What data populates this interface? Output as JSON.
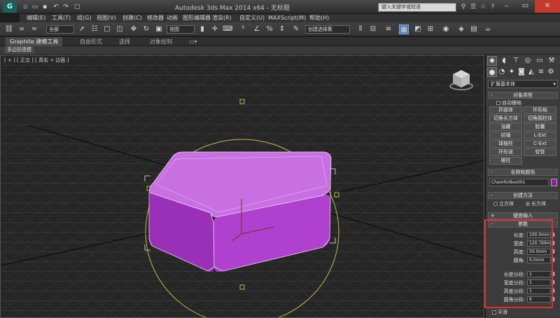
{
  "titlebar": {
    "app_logo": "G",
    "title": "Autodesk 3ds Max 2014 x64 - 无标题",
    "search_placeholder": "键入关键字或短语"
  },
  "menu": [
    "编辑(E)",
    "工具(T)",
    "组(G)",
    "视图(V)",
    "创建(C)",
    "修改器",
    "动画",
    "图形编辑器",
    "渲染(R)",
    "自定义(U)",
    "MAXScript(M)",
    "帮助(H)"
  ],
  "toolbar": {
    "selection_filter": "全部",
    "coord_system": "视图",
    "named_selection": "创建选择集"
  },
  "ribbon": {
    "tabs": [
      "Graphite 建模工具",
      "自由形式",
      "选择",
      "对象绘制"
    ],
    "subtab": "多边形建模"
  },
  "viewport": {
    "label": "[ + ] [ 正交 ] [ 真实 + 边面 ]"
  },
  "command_panel": {
    "category": "扩展基本体",
    "object_type": {
      "title": "对象类型",
      "autogrid": "自动栅格",
      "buttons": [
        "异面体",
        "环形结",
        "切角长方体",
        "切角圆柱体",
        "油罐",
        "胶囊",
        "纺锤",
        "L-Ext",
        "球棱柱",
        "C-Ext",
        "环形波",
        "软管",
        "棱柱"
      ]
    },
    "name_color": {
      "title": "名称和颜色",
      "name": "ChamferBox001",
      "color": "#8c1fa8"
    },
    "creation_method": {
      "title": "创建方法",
      "options": [
        "立方体",
        "长方体"
      ],
      "selected": "长方体"
    },
    "keyboard_entry": {
      "title": "键盘输入"
    },
    "parameters": {
      "title": "参数",
      "fields": [
        {
          "label": "长度:",
          "value": "100.0mm"
        },
        {
          "label": "宽度:",
          "value": "120.769m"
        },
        {
          "label": "高度:",
          "value": "50.0mm"
        },
        {
          "label": "圆角:",
          "value": "6.0mm"
        }
      ],
      "segments": [
        {
          "label": "长度分段:",
          "value": "1"
        },
        {
          "label": "宽度分段:",
          "value": "1"
        },
        {
          "label": "高度分段:",
          "value": "1"
        },
        {
          "label": "圆角分段:",
          "value": "6"
        }
      ],
      "smooth": "平滑"
    }
  },
  "colors": {
    "object": "#b052c8",
    "highlight": "#e0302a",
    "gizmo_circle": "#c9b74a"
  }
}
